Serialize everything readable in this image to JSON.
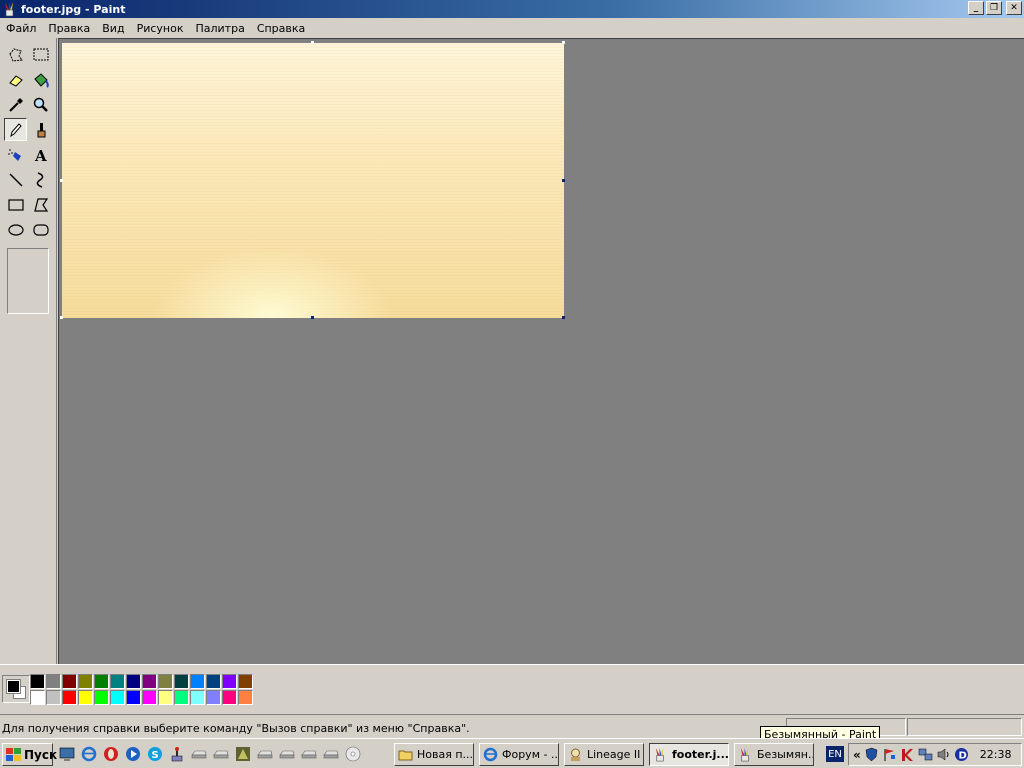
{
  "window": {
    "title": "footer.jpg - Paint",
    "controls": [
      "_",
      "❐",
      "✕"
    ]
  },
  "menu": [
    "Файл",
    "Правка",
    "Вид",
    "Рисунок",
    "Палитра",
    "Справка"
  ],
  "tools": [
    {
      "name": "free-form-select-tool",
      "icon": "free-select-icon"
    },
    {
      "name": "select-tool",
      "icon": "rect-select-icon"
    },
    {
      "name": "eraser-tool",
      "icon": "eraser-icon"
    },
    {
      "name": "fill-tool",
      "icon": "paint-bucket-icon"
    },
    {
      "name": "pick-color-tool",
      "icon": "eyedropper-icon"
    },
    {
      "name": "magnifier-tool",
      "icon": "magnifier-icon"
    },
    {
      "name": "pencil-tool",
      "icon": "pencil-icon",
      "active": true
    },
    {
      "name": "brush-tool",
      "icon": "brush-icon"
    },
    {
      "name": "airbrush-tool",
      "icon": "airbrush-icon"
    },
    {
      "name": "text-tool",
      "icon": "text-icon"
    },
    {
      "name": "line-tool",
      "icon": "line-icon"
    },
    {
      "name": "curve-tool",
      "icon": "curve-icon"
    },
    {
      "name": "rectangle-tool",
      "icon": "rectangle-icon"
    },
    {
      "name": "polygon-tool",
      "icon": "polygon-icon"
    },
    {
      "name": "ellipse-tool",
      "icon": "ellipse-icon"
    },
    {
      "name": "rounded-rectangle-tool",
      "icon": "rounded-rectangle-icon"
    }
  ],
  "palette": {
    "foreground": "#000000",
    "background": "#ffffff",
    "colors": [
      "#000000",
      "#808080",
      "#800000",
      "#808000",
      "#008000",
      "#008080",
      "#000080",
      "#800080",
      "#808040",
      "#004040",
      "#0080ff",
      "#004080",
      "#8000ff",
      "#804000",
      "#ffffff",
      "#c0c0c0",
      "#ff0000",
      "#ffff00",
      "#00ff00",
      "#00ffff",
      "#0000ff",
      "#ff00ff",
      "#ffff80",
      "#00ff80",
      "#80ffff",
      "#8080ff",
      "#ff0080",
      "#ff8040"
    ]
  },
  "status": {
    "help_text": "Для получения справки выберите команду \"Вызов справки\" из меню \"Справка\".",
    "tooltip": "Безымянный - Paint"
  },
  "taskbar": {
    "start_label": "Пуск",
    "quicklaunch": [
      "show-desktop-icon",
      "internet-explorer-icon",
      "opera-icon",
      "media-player-icon",
      "skype-icon",
      "joystick-icon",
      "drive-icon",
      "drive-icon",
      "gimp-icon",
      "drive-icon",
      "drive-icon",
      "drive-icon",
      "drive-icon",
      "cd-icon"
    ],
    "tasks": [
      {
        "label": "Новая п...",
        "icon": "folder-icon",
        "active": false
      },
      {
        "label": "Форум - ...",
        "icon": "internet-explorer-icon",
        "active": false
      },
      {
        "label": "Lineage II",
        "icon": "lineage-icon",
        "active": false
      },
      {
        "label": "footer.j...",
        "icon": "paint-icon",
        "active": true
      },
      {
        "label": "Безымян...",
        "icon": "paint-icon",
        "active": false
      }
    ],
    "language": "EN",
    "tray_arrow": "«",
    "tray_icons": [
      "shield-icon",
      "flag-icon",
      "kaspersky-icon",
      "network-icon",
      "speaker-icon",
      "daemon-tools-icon"
    ],
    "clock": "22:38"
  }
}
